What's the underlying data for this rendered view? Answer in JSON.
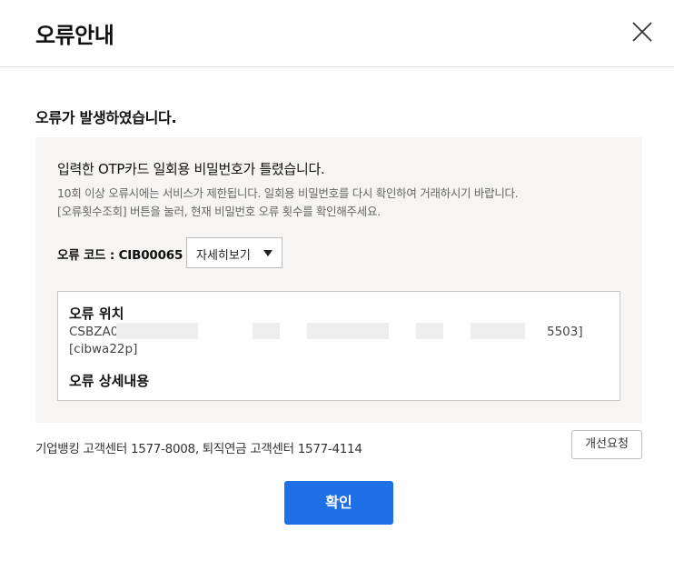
{
  "dialog": {
    "title": "오류안내",
    "close_icon": "close-icon"
  },
  "error": {
    "headline": "오류가 발생하였습니다.",
    "message": "입력한 OTP카드 일회용 비밀번호가 틀렸습니다.",
    "notes": [
      "10회 이상 오류시에는 서비스가 제한됩니다. 일회용 비밀번호를 다시 확인하여 거래하시기 바랍니다.",
      "[오류횟수조회] 버튼을 눌러, 현재 비밀번호 오류 횟수를 확인해주세요."
    ],
    "code_label": "오류 코드 : CIB00065",
    "detail_button_label": "자세히보기",
    "location_title": "오류 위치",
    "location_prefix": "CSBZA0",
    "location_suffix": "5503]",
    "location_module": "[cibwa22p]",
    "detail_title": "오류 상세내용"
  },
  "footer": {
    "contact": "기업뱅킹 고객센터 1577-8008, 퇴직연금 고객센터 1577-4114",
    "improve_button": "개선요청",
    "confirm_button": "확인"
  },
  "colors": {
    "primary": "#1f6fe6",
    "panel_bg": "#f6f5f3"
  }
}
